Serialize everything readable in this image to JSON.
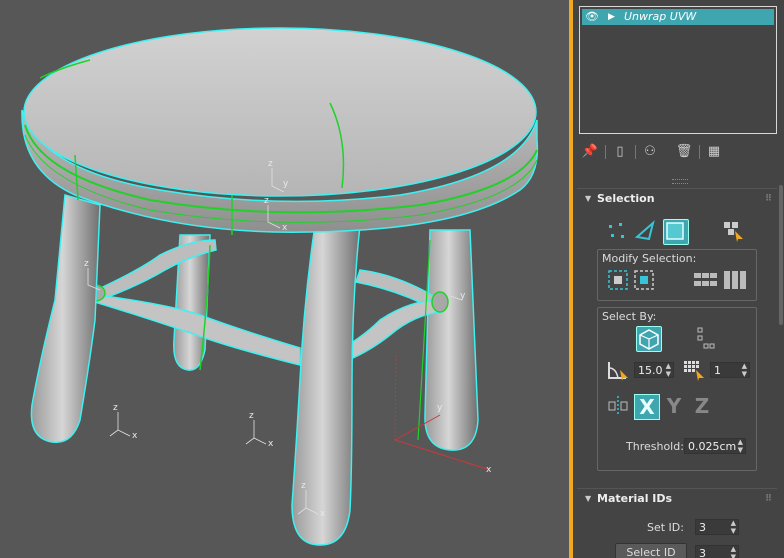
{
  "modifier_stack": {
    "item_label": "Unwrap UVW"
  },
  "toolbar": {
    "icons": [
      "pin-stack-icon",
      "show-end-result-icon",
      "make-unique-icon",
      "remove-modifier-icon",
      "configure-modifier-sets-icon"
    ]
  },
  "selection": {
    "title": "Selection",
    "modify_label": "Modify Selection:",
    "selectby_label": "Select By:",
    "angle_value": "15.0",
    "grow_value": "1",
    "x_label": "X",
    "y_label": "Y",
    "z_label": "Z",
    "threshold_label": "Threshold:",
    "threshold_value": "0.025cm"
  },
  "material_ids": {
    "title": "Material IDs",
    "set_id_label": "Set ID:",
    "set_id_value": "3",
    "select_id_label": "Select ID",
    "select_id_value": "3"
  },
  "viewport": {
    "axis_x": "x",
    "axis_y": "y",
    "axis_z": "z",
    "colors": {
      "background": "#575757",
      "selection_outline": "#3ff0f0",
      "seam": "#22d02a",
      "accent": "#f0a81f"
    }
  }
}
